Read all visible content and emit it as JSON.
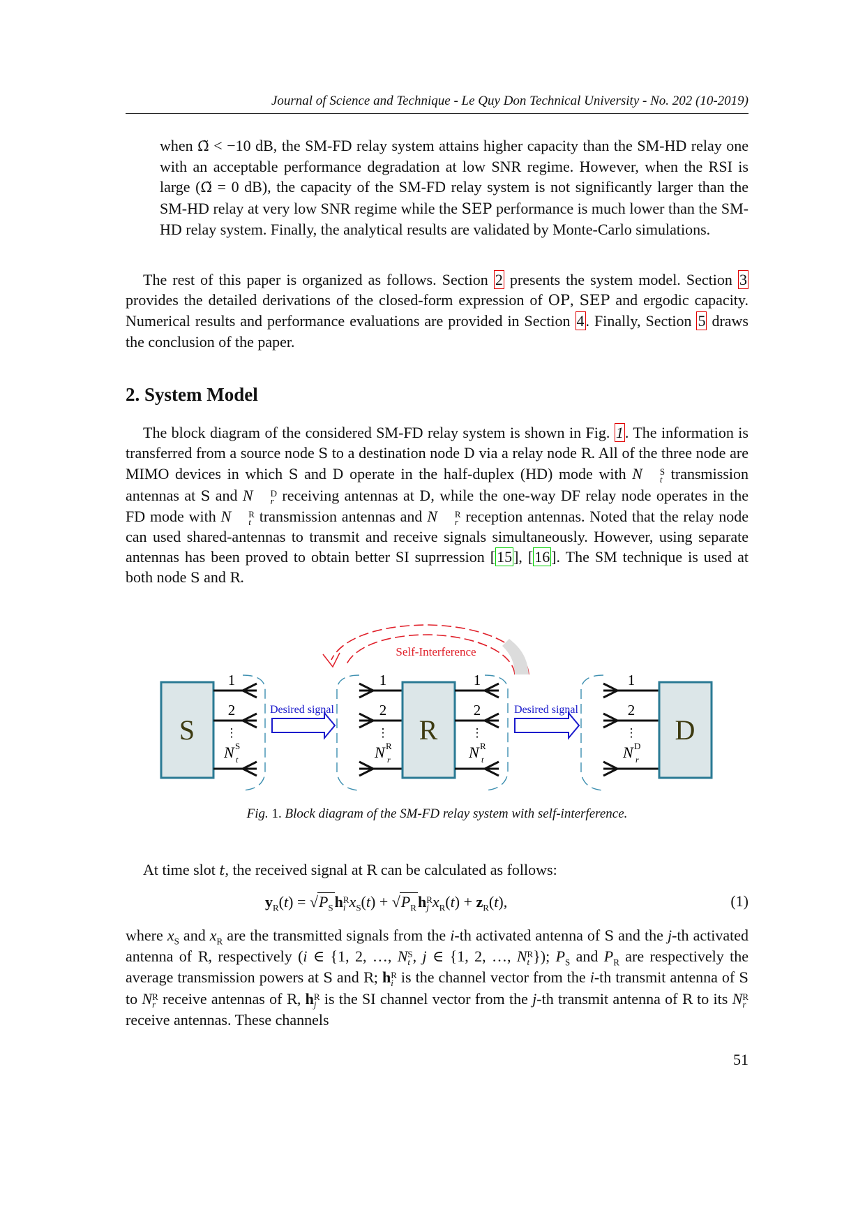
{
  "header": {
    "running_title": "Journal of Science and Technique - Le Quy Don Technical University - No. 202 (10-2019)"
  },
  "intro_list_continuation": {
    "lines": [
      "when Ω̃ < −10 dB, the SM-FD relay system attains higher capacity than the SM-HD relay one with an acceptable performance degradation at low SNR regime. However, when the RSI is large (Ω̃ = 0 dB), the capacity of the SM-FD relay system is not significantly larger than the SM-HD relay at very low SNR regime while the SEP performance is much lower than the SM-HD relay system. Finally, the analytical results are validated by Monte-Carlo simulations."
    ],
    "p1a": "when ",
    "omega": "Ω̃",
    "p1b": " < −10 dB, the SM-FD relay system attains higher capacity than the SM-HD relay one with an acceptable performance degradation at low SNR regime. However, when the RSI is large (",
    "p1c": " = 0 dB), the capacity of the SM-FD relay system is not significantly larger than the SM-HD relay at very low SNR regime while the ",
    "sep": "SEP",
    "p1d": " performance is much lower than the SM-HD relay system. Finally, the analytical results are validated by Monte-Carlo simulations."
  },
  "organization_paragraph": {
    "a": "The rest of this paper is organized as follows. Section ",
    "ref2": "2",
    "b": " presents the system model. Section ",
    "ref3": "3",
    "c": " provides the detailed derivations of the closed-form expression of ",
    "op": "OP",
    "d": ", ",
    "sep": "SEP",
    "e": " and ergodic capacity. Numerical results and performance evaluations are provided in Section ",
    "ref4": "4",
    "f": ". Finally, Section ",
    "ref5": "5",
    "g": " draws the conclusion of the paper."
  },
  "section": {
    "number": "2.",
    "title": "System Model"
  },
  "system_model_paragraph": {
    "a": "The block diagram of the considered SM-FD relay system is shown in Fig. ",
    "fig_ref": "1",
    "b": ". The information is transferred from a source node ",
    "S": "S",
    "c": " to a destination node ",
    "D": "D",
    "d": " via a relay node ",
    "R": "R",
    "e": ". All of the three node are MIMO devices in which ",
    "f": " and ",
    "g": " operate in the half-duplex (HD) mode with ",
    "h": " transmission antennas at ",
    "i": " and ",
    "j": " receiving antennas at ",
    "k": ", while the one-way DF relay node operates in the FD mode with ",
    "l": " transmission antennas and ",
    "m": " reception antennas. Noted that the relay node can used shared-antennas to transmit and receive signals simultaneously. However, using separate antennas has been proved to obtain better SI suprression [",
    "ref15": "15",
    "n": "], [",
    "ref16": "16",
    "o": "]. The SM technique is used at both node ",
    "p": " and ",
    "q": "."
  },
  "figure": {
    "nodes": [
      "S",
      "R",
      "D"
    ],
    "antenna_labels": [
      "1",
      "2",
      "⋮"
    ],
    "desired_signal_label": "Desired signal",
    "self_interference_label": "Self-Interference",
    "caption_prefix": "Fig.",
    "caption_number": "1.",
    "caption_text": "Block diagram of the SM-FD relay system with self-interference.",
    "colors": {
      "node_fill": "#dce6e8",
      "node_border": "#2a7a94",
      "desired_signal": "#1a1acc",
      "self_interference": "#e0202a",
      "antenna_group_dash": "#3d8fb0",
      "node_label": "#3d3a10"
    }
  },
  "equation_intro": {
    "a": "At time slot ",
    "t": "t",
    "b": ", the received signal at ",
    "R": "R",
    "c": " can be calculated as follows:"
  },
  "equation_1": {
    "number": "(1)"
  },
  "definitions_paragraph": {
    "a": "where ",
    "b": " and ",
    "c": " are the transmitted signals from the ",
    "d": "-th activated antenna of ",
    "e": " and the ",
    "f": "-th activated antenna of ",
    "g": ", respectively (",
    "h": "); ",
    "i": " and ",
    "j": " are respectively the average transmission powers at ",
    "k": " and ",
    "l": "; ",
    "m": " is the channel vector from the ",
    "n": "-th transmit antenna of ",
    "o": " to ",
    "p": " receive antennas of ",
    "q": ", ",
    "r": " is the SI channel vector from the ",
    "s": "-th transmit antenna of ",
    "t": " to its ",
    "u": " receive antennas. These channels"
  },
  "page_number": "51"
}
